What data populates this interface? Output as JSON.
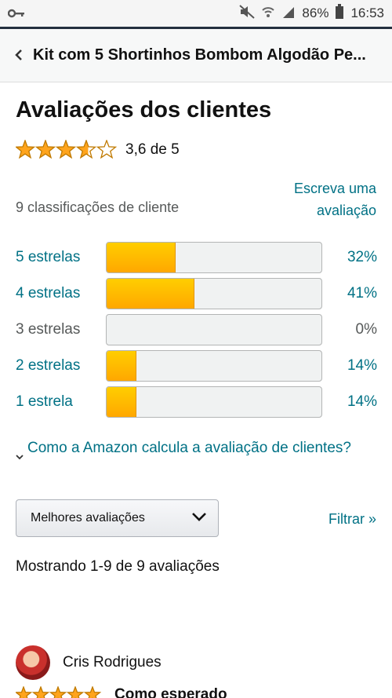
{
  "status_bar": {
    "battery": "86%",
    "time": "16:53",
    "icons": [
      "key-icon",
      "mute-icon",
      "wifi-icon",
      "signal-icon",
      "battery-icon"
    ]
  },
  "header": {
    "back_icon": "chevron-left-icon",
    "title": "Kit com 5 Shortinhos Bombom Algodão Pe..."
  },
  "page_title": "Avaliações dos clientes",
  "rating": {
    "stars": 3.6,
    "average_text": "3,6 de 5",
    "count_text": "9 classificações de cliente",
    "write_review": "Escreva uma avaliação"
  },
  "histogram": [
    {
      "label": "5 estrelas",
      "percent_text": "32%",
      "percent": 32,
      "active": true
    },
    {
      "label": "4 estrelas",
      "percent_text": "41%",
      "percent": 41,
      "active": true
    },
    {
      "label": "3 estrelas",
      "percent_text": "0%",
      "percent": 0,
      "active": false
    },
    {
      "label": "2 estrelas",
      "percent_text": "14%",
      "percent": 14,
      "active": true
    },
    {
      "label": "1 estrela",
      "percent_text": "14%",
      "percent": 14,
      "active": true
    }
  ],
  "calc_link": "Como a Amazon calcula a avaliação de clientes?",
  "sort": {
    "selected": "Melhores avaliações",
    "filter": "Filtrar »"
  },
  "showing": "Mostrando 1-9 de 9 avaliações",
  "review": {
    "reviewer": "Cris Rodrigues",
    "stars": 5,
    "title": "Como esperado"
  },
  "colors": {
    "link": "#007185",
    "star": "#ffa41c",
    "bar_fill": "#ffa700"
  }
}
